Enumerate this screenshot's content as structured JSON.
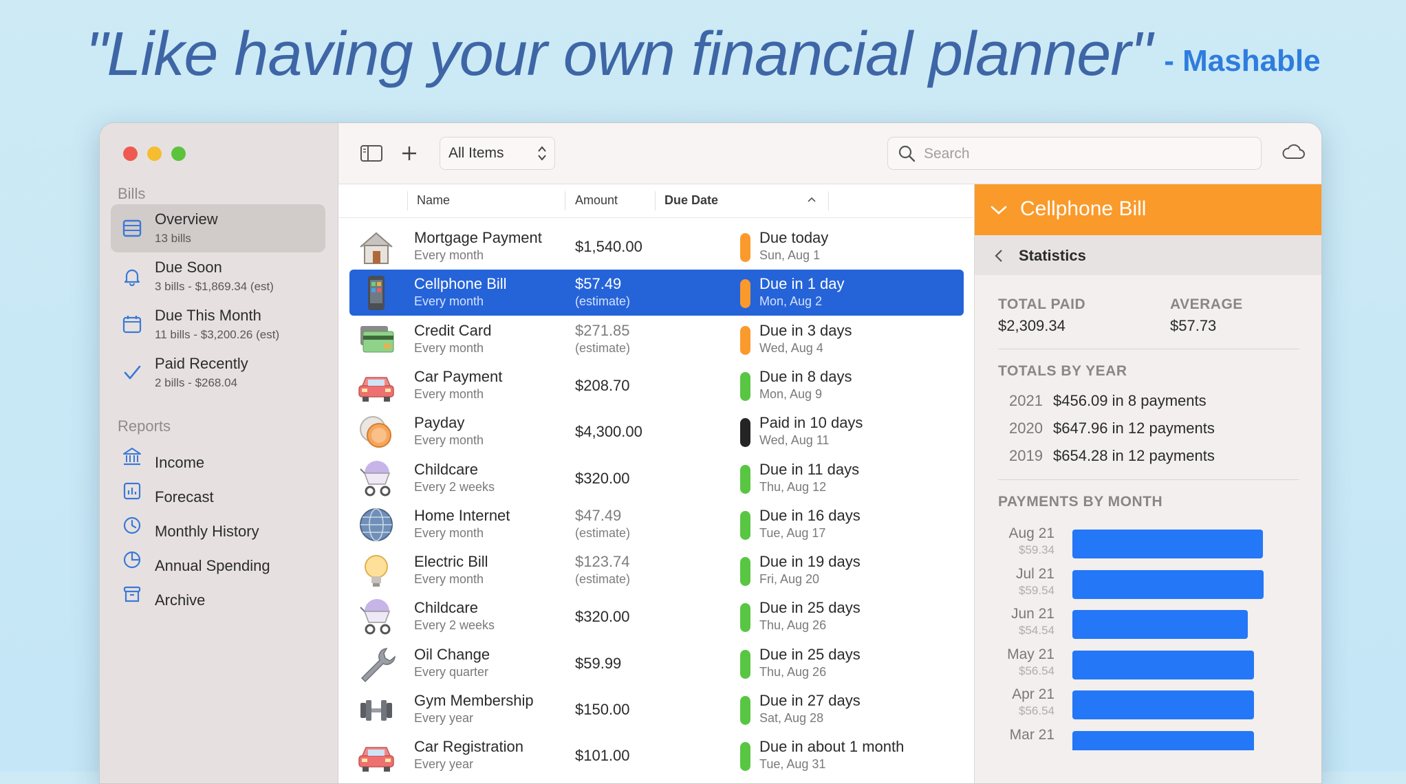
{
  "headline": {
    "quote": "\"Like having your own financial planner\"",
    "source": "- Mashable"
  },
  "sidebar": {
    "bills_heading": "Bills",
    "reports_heading": "Reports",
    "bills": [
      {
        "label": "Overview",
        "sub": "13 bills",
        "icon": "table-icon",
        "active": true
      },
      {
        "label": "Due Soon",
        "sub": "3 bills - $1,869.34 (est)",
        "icon": "bell-icon"
      },
      {
        "label": "Due This Month",
        "sub": "11 bills - $3,200.26 (est)",
        "icon": "calendar-icon"
      },
      {
        "label": "Paid Recently",
        "sub": "2 bills - $268.04",
        "icon": "checkmark-icon"
      }
    ],
    "reports": [
      {
        "label": "Income",
        "icon": "bank-icon"
      },
      {
        "label": "Forecast",
        "icon": "chart-icon"
      },
      {
        "label": "Monthly History",
        "icon": "clock-icon"
      },
      {
        "label": "Annual Spending",
        "icon": "pie-icon"
      },
      {
        "label": "Archive",
        "icon": "archive-icon"
      }
    ]
  },
  "toolbar": {
    "filter": "All Items",
    "search_placeholder": "Search"
  },
  "list": {
    "columns": {
      "name": "Name",
      "amount": "Amount",
      "due": "Due Date"
    },
    "rows": [
      {
        "name": "Mortgage Payment",
        "freq": "Every month",
        "amount": "$1,540.00",
        "amount_sub": "",
        "due": "Due today",
        "date": "Sun, Aug 1",
        "status": "orange",
        "icon": "house-icon"
      },
      {
        "name": "Cellphone Bill",
        "freq": "Every month",
        "amount": "$57.49",
        "amount_sub": "(estimate)",
        "due": "Due in 1 day",
        "date": "Mon, Aug 2",
        "status": "orange",
        "icon": "phone-icon",
        "selected": true
      },
      {
        "name": "Credit Card",
        "freq": "Every month",
        "amount": "$271.85",
        "amount_sub": "(estimate)",
        "due": "Due in 3 days",
        "date": "Wed, Aug 4",
        "status": "orange",
        "icon": "credit-card-icon"
      },
      {
        "name": "Car Payment",
        "freq": "Every month",
        "amount": "$208.70",
        "amount_sub": "",
        "due": "Due in 8 days",
        "date": "Mon, Aug 9",
        "status": "green",
        "icon": "car-icon"
      },
      {
        "name": "Payday",
        "freq": "Every month",
        "amount": "$4,300.00",
        "amount_sub": "",
        "due": "Paid in 10 days",
        "date": "Wed, Aug 11",
        "status": "black",
        "icon": "coins-icon"
      },
      {
        "name": "Childcare",
        "freq": "Every 2 weeks",
        "amount": "$320.00",
        "amount_sub": "",
        "due": "Due in 11 days",
        "date": "Thu, Aug 12",
        "status": "green",
        "icon": "stroller-icon"
      },
      {
        "name": "Home Internet",
        "freq": "Every month",
        "amount": "$47.49",
        "amount_sub": "(estimate)",
        "due": "Due in 16 days",
        "date": "Tue, Aug 17",
        "status": "green",
        "icon": "globe-icon"
      },
      {
        "name": "Electric Bill",
        "freq": "Every month",
        "amount": "$123.74",
        "amount_sub": "(estimate)",
        "due": "Due in 19 days",
        "date": "Fri, Aug 20",
        "status": "green",
        "icon": "lightbulb-icon"
      },
      {
        "name": "Childcare",
        "freq": "Every 2 weeks",
        "amount": "$320.00",
        "amount_sub": "",
        "due": "Due in 25 days",
        "date": "Thu, Aug 26",
        "status": "green",
        "icon": "stroller-icon"
      },
      {
        "name": "Oil Change",
        "freq": "Every quarter",
        "amount": "$59.99",
        "amount_sub": "",
        "due": "Due in 25 days",
        "date": "Thu, Aug 26",
        "status": "green",
        "icon": "wrench-icon"
      },
      {
        "name": "Gym Membership",
        "freq": "Every year",
        "amount": "$150.00",
        "amount_sub": "",
        "due": "Due in 27 days",
        "date": "Sat, Aug 28",
        "status": "green",
        "icon": "dumbbell-icon"
      },
      {
        "name": "Car Registration",
        "freq": "Every year",
        "amount": "$101.00",
        "amount_sub": "",
        "due": "Due in about 1 month",
        "date": "Tue, Aug 31",
        "status": "green",
        "icon": "car-icon"
      }
    ]
  },
  "detail": {
    "title": "Cellphone Bill",
    "subtitle": "Statistics",
    "total_paid_label": "TOTAL PAID",
    "total_paid": "$2,309.34",
    "average_label": "AVERAGE",
    "average": "$57.73",
    "totals_by_year_label": "TOTALS BY YEAR",
    "years": [
      {
        "year": "2021",
        "value": "$456.09 in 8 payments"
      },
      {
        "year": "2020",
        "value": "$647.96 in 12 payments"
      },
      {
        "year": "2019",
        "value": "$654.28 in 12 payments"
      }
    ],
    "payments_by_month_label": "PAYMENTS BY MONTH",
    "months": [
      {
        "month": "Aug 21",
        "amount": "$59.34",
        "value": 59.34
      },
      {
        "month": "Jul 21",
        "amount": "$59.54",
        "value": 59.54
      },
      {
        "month": "Jun 21",
        "amount": "$54.54",
        "value": 54.54
      },
      {
        "month": "May 21",
        "amount": "$56.54",
        "value": 56.54
      },
      {
        "month": "Apr 21",
        "amount": "$56.54",
        "value": 56.54
      },
      {
        "month": "Mar 21",
        "amount": "",
        "value": 56.54
      }
    ]
  },
  "colors": {
    "accent": "#2563d9",
    "orange": "#fb9a2c",
    "green": "#58c643",
    "black": "#242424",
    "bar": "#2477f6"
  }
}
